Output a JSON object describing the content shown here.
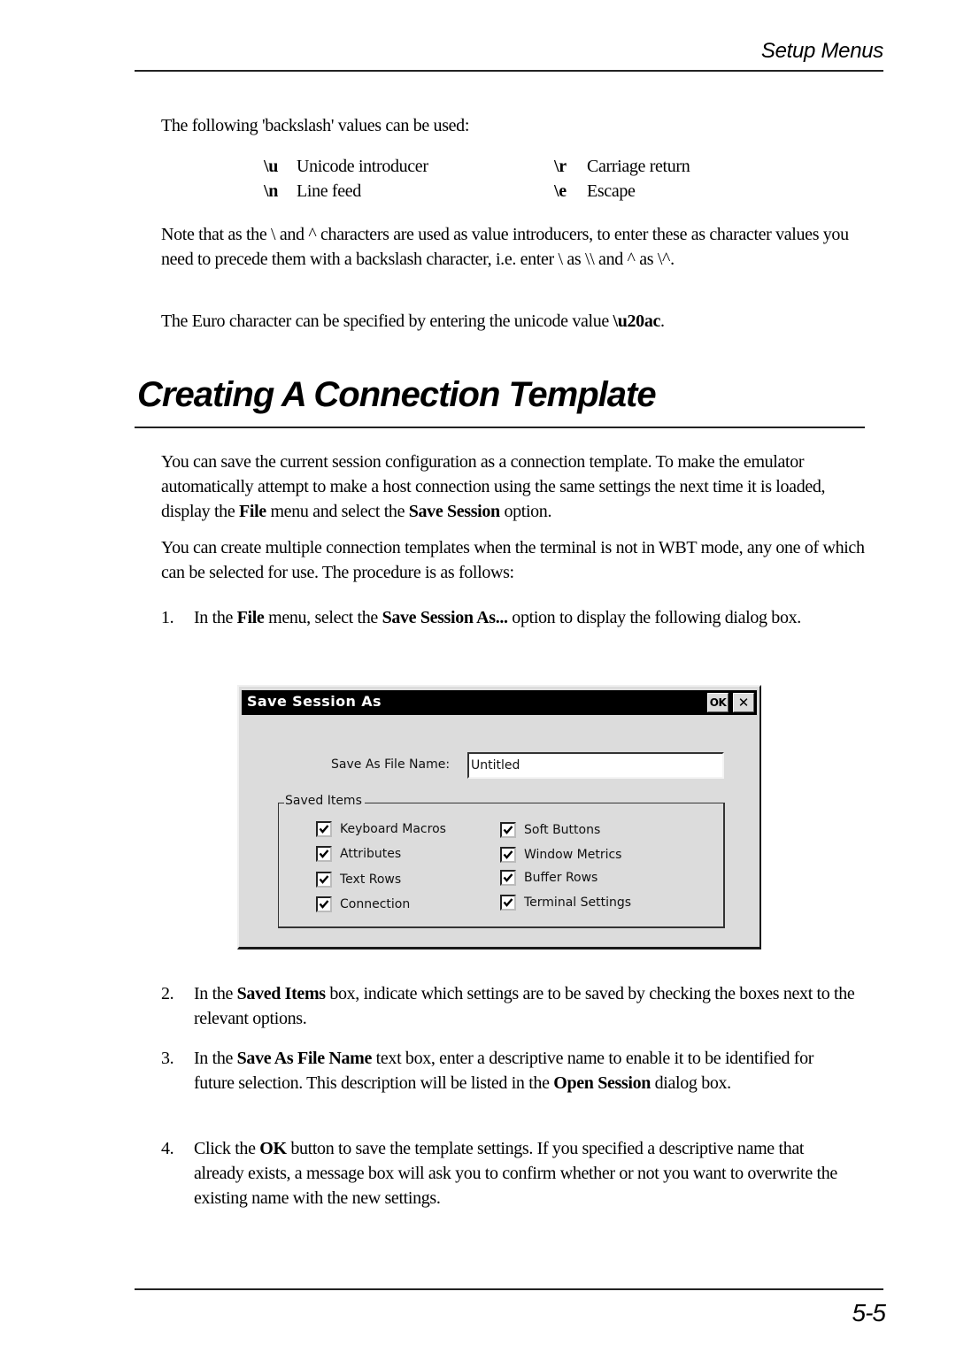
{
  "header": {
    "running_title": "Setup Menus",
    "page_number": "5-5"
  },
  "intro": {
    "backslash_intro": "The following 'backslash' values can be used:",
    "backslash_values": [
      {
        "code": "\\u",
        "description": "Unicode introducer"
      },
      {
        "code": "\\r",
        "description": "Carriage return"
      },
      {
        "code": "\\n",
        "description": "Line feed"
      },
      {
        "code": "\\e",
        "description": "Escape"
      }
    ],
    "note_parts": [
      "Note that as the \\ and ^ characters are used as value introducers, to enter these as character values you need to precede them with a backslash character, i.e. enter \\ as \\\\ and ^ as \\^."
    ],
    "euro_text": "The Euro character can be specified by entering the unicode value ",
    "euro_code": "\\u20ac",
    "euro_end": "."
  },
  "section": {
    "title": "Creating A Connection Template",
    "p1": {
      "a": "You can save the current session configuration as a connection template. To make the emulator automatically attempt to make a host connection using the same settings the next time it is loaded, display the ",
      "b": "File",
      "c": " menu and select the ",
      "d": "Save Session",
      "e": " option."
    },
    "p2": "You can create multiple connection templates when the terminal is not in WBT mode, any one of which can be selected for use. The procedure is as follows:",
    "steps": [
      {
        "num": "1.",
        "a": "In the ",
        "b": "File",
        "c": " menu, select the ",
        "d": "Save Session As...",
        "e": " option to display the following dialog box."
      },
      {
        "num": "2.",
        "a": "In the ",
        "b": "Saved Items",
        "c": " box, indicate which settings are to be saved by checking the boxes next to the relevant options."
      },
      {
        "num": "3.",
        "a": "In the ",
        "b": "Save As File Name",
        "c": " text box, enter a descriptive name to enable it to be identified for future selection. This description will be listed in the ",
        "d": "Open Session",
        "e": " dialog box."
      },
      {
        "num": "4.",
        "a": "Click the ",
        "b": "OK",
        "c": " button to save the template settings. If you specified a descriptive name that already exists, a message box will ask you to confirm whether or not you want to overwrite the existing name with the new settings."
      }
    ]
  },
  "dialog": {
    "title": "Save Session As",
    "ok_label": "OK",
    "close_glyph": "✕",
    "file_name_label": "Save As File Name:",
    "file_name_value": "Untitled",
    "group_label": "Saved Items",
    "checkboxes": [
      {
        "label": "Keyboard Macros",
        "checked": true
      },
      {
        "label": "Attributes",
        "checked": true
      },
      {
        "label": "Text Rows",
        "checked": true
      },
      {
        "label": "Connection",
        "checked": true
      },
      {
        "label": "Soft Buttons",
        "checked": true
      },
      {
        "label": "Window Metrics",
        "checked": true
      },
      {
        "label": "Buffer Rows",
        "checked": true
      },
      {
        "label": "Terminal Settings",
        "checked": true
      }
    ]
  }
}
